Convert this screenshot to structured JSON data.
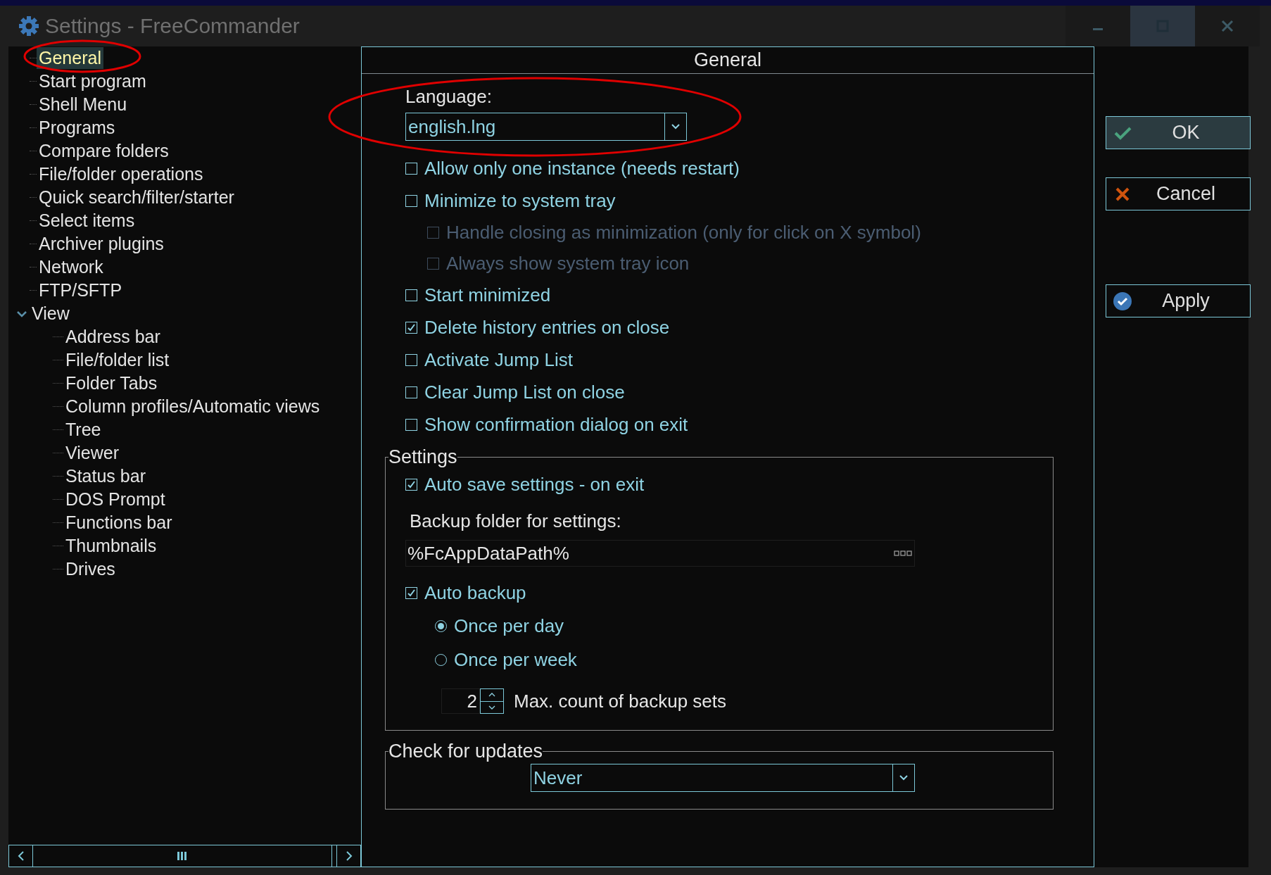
{
  "window": {
    "title": "Settings - FreeCommander"
  },
  "tree": {
    "items": [
      {
        "label": "General",
        "selected": true
      },
      {
        "label": "Start program",
        "selected": false
      },
      {
        "label": "Shell Menu",
        "selected": false
      },
      {
        "label": "Programs",
        "selected": false
      },
      {
        "label": "Compare folders",
        "selected": false
      },
      {
        "label": "File/folder operations",
        "selected": false
      },
      {
        "label": "Quick search/filter/starter",
        "selected": false
      },
      {
        "label": "Select items",
        "selected": false
      },
      {
        "label": "Archiver plugins",
        "selected": false
      },
      {
        "label": "Network",
        "selected": false
      },
      {
        "label": "FTP/SFTP",
        "selected": false
      },
      {
        "label": "View",
        "selected": false,
        "expanded": true,
        "children": [
          {
            "label": "Address bar",
            "selected": false
          },
          {
            "label": "File/folder list",
            "selected": false
          },
          {
            "label": "Folder Tabs",
            "selected": false
          },
          {
            "label": "Column profiles/Automatic views",
            "selected": false
          },
          {
            "label": "Tree",
            "selected": false
          },
          {
            "label": "Viewer",
            "selected": false
          },
          {
            "label": "Status bar",
            "selected": false
          },
          {
            "label": "DOS Prompt",
            "selected": false
          },
          {
            "label": "Functions bar",
            "selected": false
          },
          {
            "label": "Thumbnails",
            "selected": false
          },
          {
            "label": "Drives",
            "selected": false
          }
        ]
      }
    ]
  },
  "panel": {
    "title": "General",
    "language": {
      "label": "Language:",
      "value": "english.lng"
    },
    "options": [
      {
        "label": "Allow only one instance (needs restart)",
        "checked": false,
        "disabled": false
      },
      {
        "label": "Minimize to system tray",
        "checked": false,
        "disabled": false,
        "children": [
          {
            "label": "Handle closing as minimization (only for click on X symbol)",
            "checked": false,
            "disabled": true
          },
          {
            "label": "Always show system tray icon",
            "checked": false,
            "disabled": true
          }
        ]
      },
      {
        "label": "Start minimized",
        "checked": false,
        "disabled": false
      },
      {
        "label": "Delete history entries on close",
        "checked": true,
        "disabled": false
      },
      {
        "label": "Activate Jump List",
        "checked": false,
        "disabled": false
      },
      {
        "label": "Clear Jump List on close",
        "checked": false,
        "disabled": false
      },
      {
        "label": "Show confirmation dialog on exit",
        "checked": false,
        "disabled": false
      }
    ],
    "settings": {
      "title": "Settings",
      "auto_save": {
        "label": "Auto save settings - on exit",
        "checked": true
      },
      "backup_folder": {
        "label": "Backup folder for settings:",
        "value": "%FcAppDataPath%"
      },
      "auto_backup": {
        "label": "Auto backup",
        "checked": true
      },
      "frequency": [
        {
          "label": "Once per day",
          "selected": true
        },
        {
          "label": "Once per week",
          "selected": false
        }
      ],
      "max_count": {
        "value": "2",
        "label": "Max. count of backup sets"
      }
    },
    "updates": {
      "title": "Check for updates",
      "value": "Never"
    }
  },
  "buttons": [
    {
      "label": "OK",
      "kind": "ok",
      "default": true
    },
    {
      "label": "Cancel",
      "kind": "cancel",
      "default": false
    },
    {
      "label": "Apply",
      "kind": "apply",
      "default": false
    }
  ]
}
